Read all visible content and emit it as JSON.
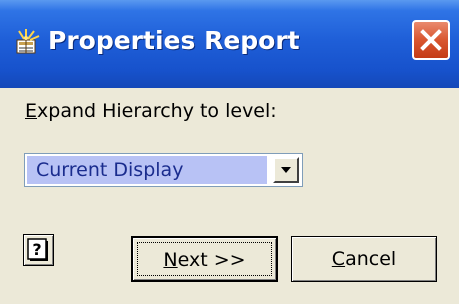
{
  "window": {
    "title": "Properties Report",
    "title_icon": "report-app-icon",
    "close_icon": "close-icon"
  },
  "form": {
    "label_access_key": "E",
    "label_rest": "xpand Hierarchy to level:",
    "select_value": "Current Display",
    "select_arrow_icon": "chevron-down-icon"
  },
  "buttons": {
    "help_icon": "help-question-icon",
    "next_access_key": "N",
    "next_rest": "ext >>",
    "cancel_access_key": "C",
    "cancel_rest": "ancel"
  },
  "colors": {
    "titlebar": "#1F5FD8",
    "dialog_background": "#ECE9D8",
    "close_button": "#D9562F",
    "selection_highlight": "#B8C2F5",
    "selection_text": "#1A2C8E"
  }
}
